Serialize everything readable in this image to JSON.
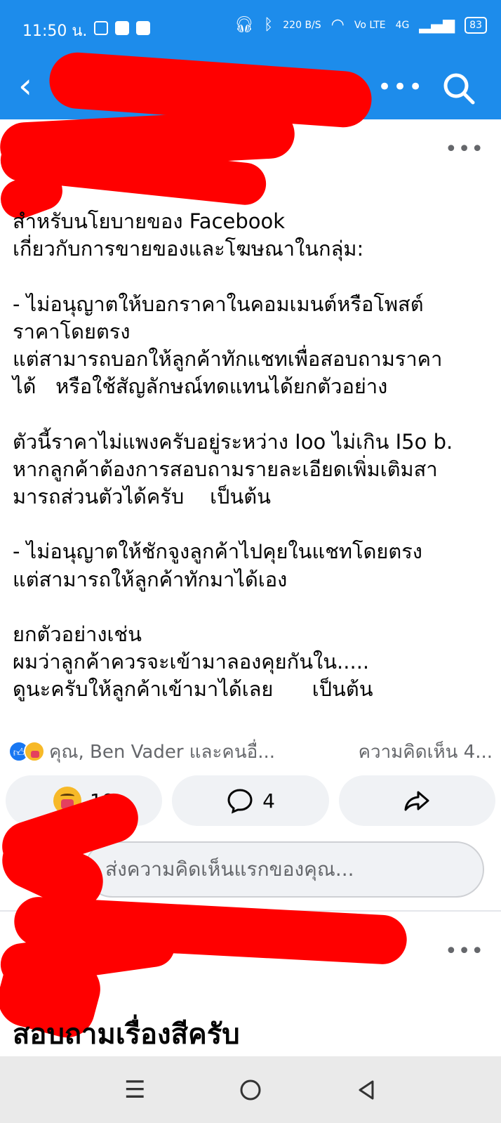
{
  "status_bar": {
    "time": "11:50 น.",
    "net_speed": "220",
    "net_unit": "B/S",
    "volte": "Vo LTE",
    "network": "4G",
    "battery": "83"
  },
  "appbar": {
    "back_icon": "back-arrow-icon",
    "more_icon": "more-horizontal-icon",
    "search_icon": "search-icon"
  },
  "post": {
    "more_label": "•••",
    "body": "สำหรับนโยบายของ Facebook\nเกี่ยวกับการขายของและโฆษณาในกลุ่ม:\n\n- ไม่อนุญาตให้บอกราคาในคอมเมนต์หรือโพสต์\nราคาโดยตรง\nแต่สามารถบอกให้ลูกค้าทักแชทเพื่อสอบถามราคา\nได้   หรือใช้สัญลักษณ์ทดแทนได้ยกตัวอย่าง\n\nตัวนี้ราคาไม่แพงครับอยู่ระหว่าง Ioo ไม่เกิน I5o b.\nหากลูกค้าต้องการสอบถามรายละเอียดเพิ่มเติมสา\nมารถส่วนตัวได้ครับ    เป็นต้น\n\n- ไม่อนุญาตให้ชักจูงลูกค้าไปคุยในแชทโดยตรง\nแต่สามารถให้ลูกค้าทักมาได้เอง\n\nยกตัวอย่างเช่น\nผมว่าลูกค้าควรจะเข้ามาลองคุยกันใน.....\nดูนะครับให้ลูกค้าเข้ามาได้เลย      เป็นต้น",
    "reactions_names": "คุณ, Ben Vader และคนอื่...",
    "comments_summary": "ความคิดเห็น 4...",
    "reaction_count": "19",
    "comment_count": "4",
    "comment_placeholder": "ส่งความคิดเห็นแรกของคุณ..."
  },
  "post2": {
    "more_label": "•••",
    "title": "สอบถามเรื่องสีครับ"
  },
  "colors": {
    "brand_blue": "#1d8ceb",
    "redaction": "#ff0000"
  }
}
